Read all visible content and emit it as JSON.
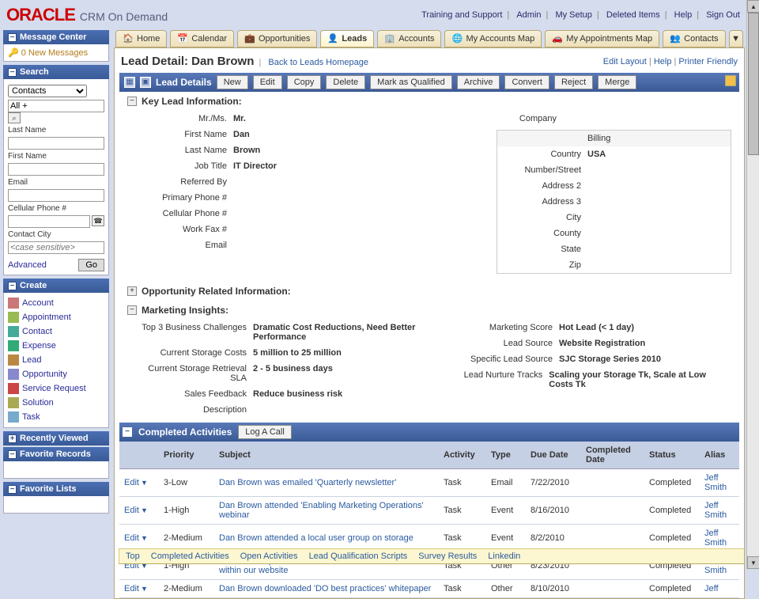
{
  "app": {
    "logo_brand": "ORACLE",
    "logo_sub": "CRM On Demand"
  },
  "toplinks": {
    "training": "Training and Support",
    "admin": "Admin",
    "mysetup": "My Setup",
    "deleted": "Deleted Items",
    "help": "Help",
    "signout": "Sign Out"
  },
  "sidebar": {
    "msgcenter": {
      "title": "Message Center",
      "new_msgs": "0 New Messages"
    },
    "search": {
      "title": "Search",
      "type": "Contacts",
      "all_label": "All +",
      "lbl_last": "Last Name",
      "lbl_first": "First Name",
      "lbl_email": "Email",
      "lbl_cell": "Cellular Phone #",
      "lbl_city": "Contact City",
      "city_placeholder": "<case sensitive>",
      "advanced": "Advanced",
      "go": "Go"
    },
    "create": {
      "title": "Create",
      "items": [
        "Account",
        "Appointment",
        "Contact",
        "Expense",
        "Lead",
        "Opportunity",
        "Service Request",
        "Solution",
        "Task"
      ]
    },
    "recent": {
      "title": "Recently Viewed"
    },
    "favrec": {
      "title": "Favorite Records"
    },
    "favlist": {
      "title": "Favorite Lists"
    }
  },
  "tabs": {
    "items": [
      "Home",
      "Calendar",
      "Opportunities",
      "Leads",
      "Accounts",
      "My Accounts Map",
      "My Appointments Map",
      "Contacts"
    ],
    "active_index": 3
  },
  "page": {
    "title": "Lead Detail: Dan Brown",
    "back": "Back to Leads Homepage",
    "rightlinks": {
      "editlayout": "Edit Layout",
      "help": "Help",
      "printer": "Printer Friendly"
    },
    "sectionbar": {
      "title": "Lead Details"
    },
    "buttons": {
      "new": "New",
      "edit": "Edit",
      "copy": "Copy",
      "delete": "Delete",
      "mark": "Mark as Qualified",
      "archive": "Archive",
      "convert": "Convert",
      "reject": "Reject",
      "merge": "Merge"
    },
    "key": {
      "hdr": "Key Lead Information:",
      "left": {
        "mrms_lbl": "Mr./Ms.",
        "mrms": "Mr.",
        "first_lbl": "First Name",
        "first": "Dan",
        "last_lbl": "Last Name",
        "last": "Brown",
        "jt_lbl": "Job Title",
        "jt": "IT Director",
        "ref_lbl": "Referred By",
        "pphone_lbl": "Primary Phone #",
        "cphone_lbl": "Cellular Phone #",
        "fax_lbl": "Work Fax #",
        "email_lbl": "Email"
      },
      "right": {
        "company_lbl": "Company",
        "billing": "Billing",
        "country_lbl": "Country",
        "country": "USA",
        "numstreet_lbl": "Number/Street",
        "addr2_lbl": "Address 2",
        "addr3_lbl": "Address 3",
        "city_lbl": "City",
        "county_lbl": "County",
        "state_lbl": "State",
        "zip_lbl": "Zip"
      }
    },
    "opp": {
      "hdr": "Opportunity Related Information:"
    },
    "mi": {
      "hdr": "Marketing Insights:",
      "left": {
        "c1_lbl": "Top 3 Business Challenges",
        "c1": "Dramatic Cost Reductions, Need Better Performance",
        "c2_lbl": "Current Storage Costs",
        "c2": "5 million to 25 million",
        "c3_lbl": "Current Storage Retrieval SLA",
        "c3": "2 - 5 business days",
        "c4_lbl": "Sales Feedback",
        "c4": "Reduce business risk",
        "c5_lbl": "Description"
      },
      "right": {
        "r1_lbl": "Marketing Score",
        "r1": "Hot Lead (< 1 day)",
        "r2_lbl": "Lead Source",
        "r2": "Website Registration",
        "r3_lbl": "Specific Lead Source",
        "r3": "SJC Storage Series 2010",
        "r4_lbl": "Lead Nurture Tracks",
        "r4": "Scaling your Storage Tk, Scale at Low Costs Tk"
      }
    },
    "activities": {
      "hdr": "Completed Activities",
      "logbtn": "Log A Call",
      "cols": {
        "priority": "Priority",
        "subject": "Subject",
        "activity": "Activity",
        "type": "Type",
        "due": "Due Date",
        "completed": "Completed Date",
        "status": "Status",
        "alias": "Alias",
        "edit": "Edit"
      },
      "rows": [
        {
          "priority": "3-Low",
          "subject": "Dan Brown was emailed 'Quarterly newsletter'",
          "activity": "Task",
          "type": "Email",
          "due": "7/22/2010",
          "completed": "",
          "status": "Completed",
          "alias": "Jeff Smith"
        },
        {
          "priority": "1-High",
          "subject": "Dan Brown attended 'Enabling Marketing Operations' webinar",
          "activity": "Task",
          "type": "Event",
          "due": "8/16/2010",
          "completed": "",
          "status": "Completed",
          "alias": "Jeff Smith"
        },
        {
          "priority": "2-Medium",
          "subject": "Dan Brown attended a local user group on storage",
          "activity": "Task",
          "type": "Event",
          "due": "8/2/2010",
          "completed": "",
          "status": "Completed",
          "alias": "Jeff Smith"
        },
        {
          "priority": "1-High",
          "subject": "Dan Brown spent 15 minutes on the solutions section within our website",
          "activity": "Task",
          "type": "Other",
          "due": "8/23/2010",
          "completed": "",
          "status": "Completed",
          "alias": "Jeff Smith"
        },
        {
          "priority": "2-Medium",
          "subject": "Dan Brown downloaded 'DO best practices' whitepaper",
          "activity": "Task",
          "type": "Other",
          "due": "8/10/2010",
          "completed": "",
          "status": "Completed",
          "alias": "Jeff"
        }
      ]
    },
    "botlinks": {
      "top": "Top",
      "ca": "Completed Activities",
      "oa": "Open Activities",
      "lqs": "Lead Qualification Scripts",
      "sr": "Survey Results",
      "li": "Linkedin"
    }
  }
}
